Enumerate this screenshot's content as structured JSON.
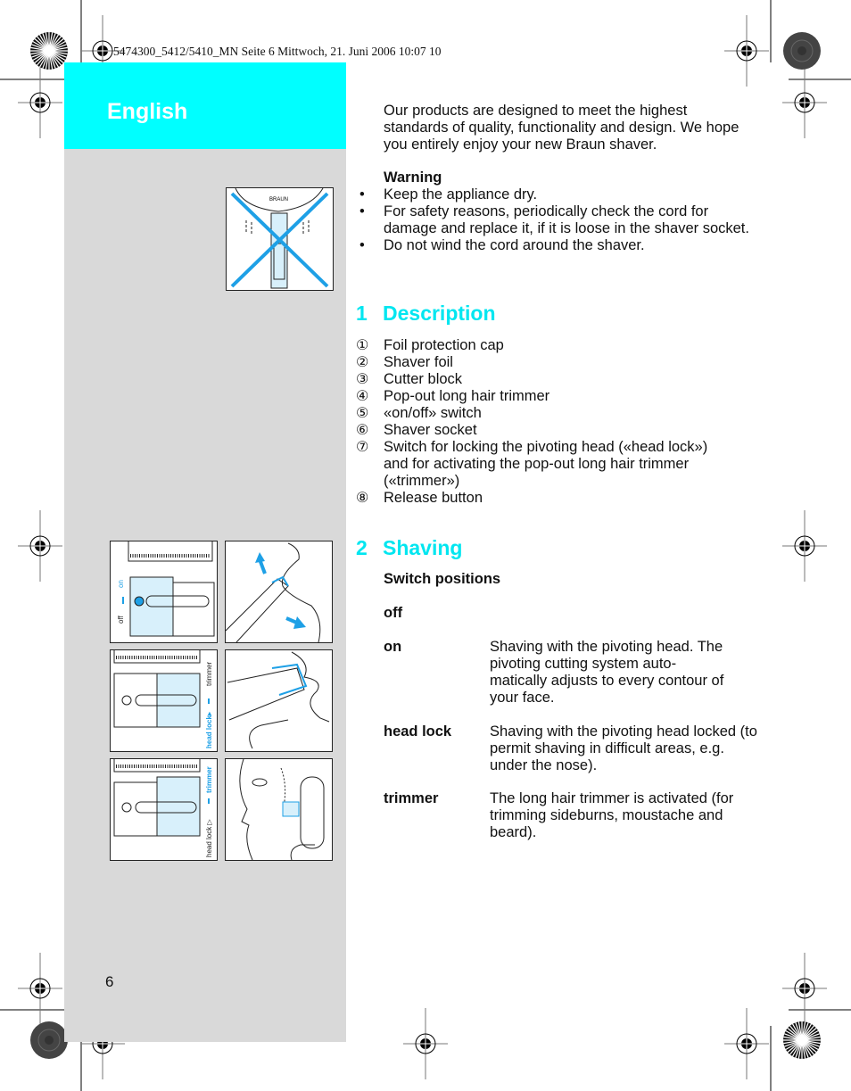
{
  "print_header": "5474300_5412/5410_MN  Seite 6  Mittwoch, 21. Juni 2006  10:07 10",
  "language": "English",
  "page_number": "6",
  "colors": {
    "accent": "#00ffff",
    "heading": "#00e6f0",
    "sidebar": "#d9d9d9",
    "illustration_blue": "#1ea0e6",
    "illustration_fill": "#d8f0fb"
  },
  "intro": "Our products are designed to meet the highest standards of quality, functionality and design. We hope you entirely enjoy your new Braun shaver.",
  "warning": {
    "title": "Warning",
    "items": [
      "Keep the appliance dry.",
      "For safety reasons, periodically check the cord for damage and replace it, if it is loose in the shaver socket.",
      "Do not wind the cord around the shaver."
    ]
  },
  "description": {
    "number": "1",
    "title": "Description",
    "items": [
      {
        "marker": "①",
        "text": "Foil protection cap"
      },
      {
        "marker": "②",
        "text": "Shaver foil"
      },
      {
        "marker": "③",
        "text": "Cutter block"
      },
      {
        "marker": "④",
        "text": "Pop-out long hair trimmer"
      },
      {
        "marker": "⑤",
        "text": "«on/off» switch"
      },
      {
        "marker": "⑥",
        "text": "Shaver socket"
      },
      {
        "marker": "⑦",
        "text": "Switch for locking the pivoting head («head lock») and for activating the pop-out long hair trimmer («trimmer»)"
      },
      {
        "marker": "⑧",
        "text": "Release button"
      }
    ]
  },
  "shaving": {
    "number": "2",
    "title": "Shaving",
    "subtitle": "Switch positions",
    "positions": [
      {
        "label": "off",
        "text": ""
      },
      {
        "label": "on",
        "text": "Shaving with the pivoting head. The pivoting cutting system auto-matically adjusts to every contour of your face."
      },
      {
        "label": "head lock",
        "text": "Shaving with the pivoting head locked (to permit shaving in difficult areas, e.g. under the nose)."
      },
      {
        "label": "trimmer",
        "text": "The long hair trimmer is activated (for trimming sideburns, moustache and beard)."
      }
    ]
  },
  "figures": {
    "warning_image": {
      "icon": "crossed-out-shaver-in-water",
      "brand_label": "BRAUN"
    },
    "switch_on": {
      "labels": [
        "off",
        "on"
      ]
    },
    "switch_headlock": {
      "labels": [
        "head lock▸",
        "trimmer"
      ]
    },
    "switch_trimmer": {
      "labels": [
        "head lock ▷",
        "trimmer"
      ]
    }
  }
}
